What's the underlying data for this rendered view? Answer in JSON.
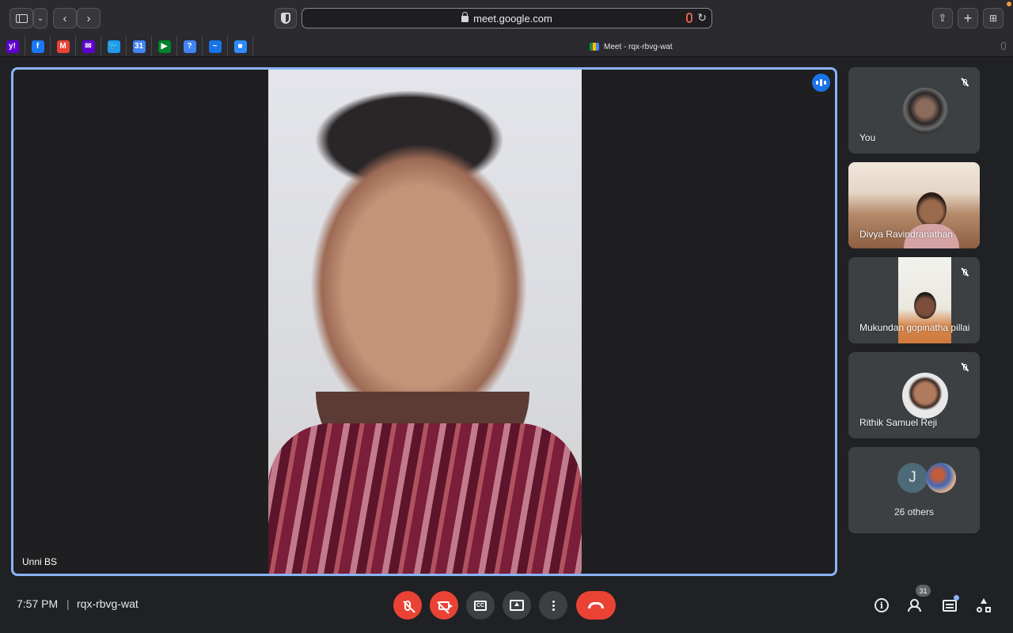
{
  "browser": {
    "url": "meet.google.com",
    "tab_title": "Meet - rqx-rbvg-wat",
    "bookmarks": [
      {
        "icon": "yahoo-icon",
        "letter": "y!",
        "color": "#6001d2"
      },
      {
        "icon": "facebook-icon",
        "letter": "f",
        "color": "#1877f2"
      },
      {
        "icon": "gmail-icon",
        "letter": "M",
        "color": "#ea4335"
      },
      {
        "icon": "yahoo-mail-icon",
        "letter": "✉",
        "color": "#5f01d1"
      },
      {
        "icon": "twitter-icon",
        "letter": "🐦",
        "color": "#1d9bf0"
      },
      {
        "icon": "google-calendar-icon",
        "letter": "31",
        "color": "#4285f4"
      },
      {
        "icon": "google-meet-icon",
        "letter": "▶",
        "color": "#00832d"
      },
      {
        "icon": "google-keep-icon",
        "letter": "?",
        "color": "#4285f4"
      },
      {
        "icon": "stocks-icon",
        "letter": "~",
        "color": "#1a73e8"
      },
      {
        "icon": "zoom-icon",
        "letter": "■",
        "color": "#2d8cff"
      }
    ]
  },
  "main_speaker": {
    "name": "Unni BS"
  },
  "participants": [
    {
      "name": "You",
      "muted": true
    },
    {
      "name": "Divya Ravindranathan",
      "muted": false
    },
    {
      "name": "Mukundan gopinatha pillai",
      "muted": true
    },
    {
      "name": "Rithik Samuel Reji",
      "muted": true
    }
  ],
  "others": {
    "initial": "J",
    "label": "26 others"
  },
  "meeting": {
    "time": "7:57 PM",
    "separator": "|",
    "code": "rqx-rbvg-wat",
    "people_count": "31"
  },
  "colors": {
    "accent": "#8ab4f8",
    "danger": "#ea4335",
    "tile": "#3c4043",
    "speaking": "#1a73e8"
  }
}
